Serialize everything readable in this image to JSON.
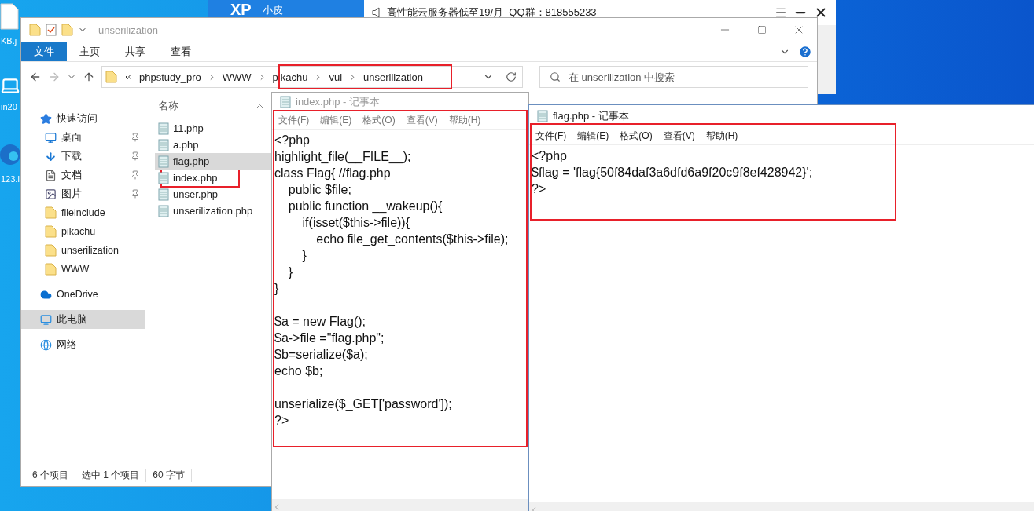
{
  "desktop": {
    "icons": [
      {
        "label": "KB.j",
        "kind": "file"
      },
      {
        "label": "in20",
        "kind": "laptop"
      },
      {
        "label": "123.l",
        "kind": "browser"
      }
    ]
  },
  "xp_window": {
    "logo": "XP",
    "name": "小皮"
  },
  "ad_bar": {
    "text": "高性能云服务器低至19/月  QQ群：818555233"
  },
  "explorer": {
    "title": "unserilization",
    "ribbon_tabs": [
      {
        "label": "文件",
        "selected": true
      },
      {
        "label": "主页",
        "selected": false
      },
      {
        "label": "共享",
        "selected": false
      },
      {
        "label": "查看",
        "selected": false
      }
    ],
    "address": {
      "crumbs": [
        "phpstudy_pro",
        "WWW",
        "pikachu",
        "vul",
        "unserilization"
      ]
    },
    "search": {
      "placeholder": "在 unserilization 中搜索"
    },
    "nav": [
      {
        "label": "快速访问",
        "kind": "quick",
        "selected": false,
        "children": [
          {
            "label": "桌面",
            "kind": "desktop",
            "selected": false,
            "pinned": true
          },
          {
            "label": "下载",
            "kind": "download",
            "selected": false,
            "pinned": true
          },
          {
            "label": "文档",
            "kind": "documents",
            "selected": false,
            "pinned": true
          },
          {
            "label": "图片",
            "kind": "pictures",
            "selected": false,
            "pinned": true
          },
          {
            "label": "fileinclude",
            "kind": "folder",
            "selected": false,
            "pinned": false
          },
          {
            "label": "pikachu",
            "kind": "folder",
            "selected": false,
            "pinned": false
          },
          {
            "label": "unserilization",
            "kind": "folder",
            "selected": false,
            "pinned": false
          },
          {
            "label": "WWW",
            "kind": "folder",
            "selected": false,
            "pinned": false
          }
        ]
      },
      {
        "label": "OneDrive",
        "kind": "onedrive",
        "selected": false
      },
      {
        "label": "此电脑",
        "kind": "pc",
        "selected": true
      },
      {
        "label": "网络",
        "kind": "network",
        "selected": false
      }
    ],
    "column": "名称",
    "files": [
      {
        "name": "11.php",
        "selected": false
      },
      {
        "name": "a.php",
        "selected": false
      },
      {
        "name": "flag.php",
        "selected": true
      },
      {
        "name": "index.php",
        "selected": false
      },
      {
        "name": "unser.php",
        "selected": false
      },
      {
        "name": "unserilization.php",
        "selected": false
      }
    ],
    "status": [
      "6 个项目",
      "选中 1 个项目",
      "60 字节"
    ]
  },
  "notepads": [
    {
      "title": "index.php - 记事本",
      "active": false,
      "menu": [
        "文件(F)",
        "编辑(E)",
        "格式(O)",
        "查看(V)",
        "帮助(H)"
      ],
      "blocks": [
        [
          "<?php",
          "highlight_file(__FILE__);",
          "class Flag{ //flag.php",
          "    public $file;",
          "    public function __wakeup(){",
          "        if(isset($this->file)){",
          "            echo file_get_contents($this->file);",
          "        }",
          "    }",
          "}"
        ],
        [
          "$a = new Flag();",
          "$a->file =\"flag.php\";",
          "$b=serialize($a);",
          "echo $b;"
        ],
        [
          "unserialize($_GET['password']);",
          "?>"
        ]
      ]
    },
    {
      "title": "flag.php - 记事本",
      "active": true,
      "menu": [
        "文件(F)",
        "编辑(E)",
        "格式(O)",
        "查看(V)",
        "帮助(H)"
      ],
      "blocks": [
        [
          "<?php",
          "$flag = 'flag{50f84daf3a6dfd6a9f20c9f8ef428942}';",
          "?>"
        ]
      ]
    }
  ]
}
